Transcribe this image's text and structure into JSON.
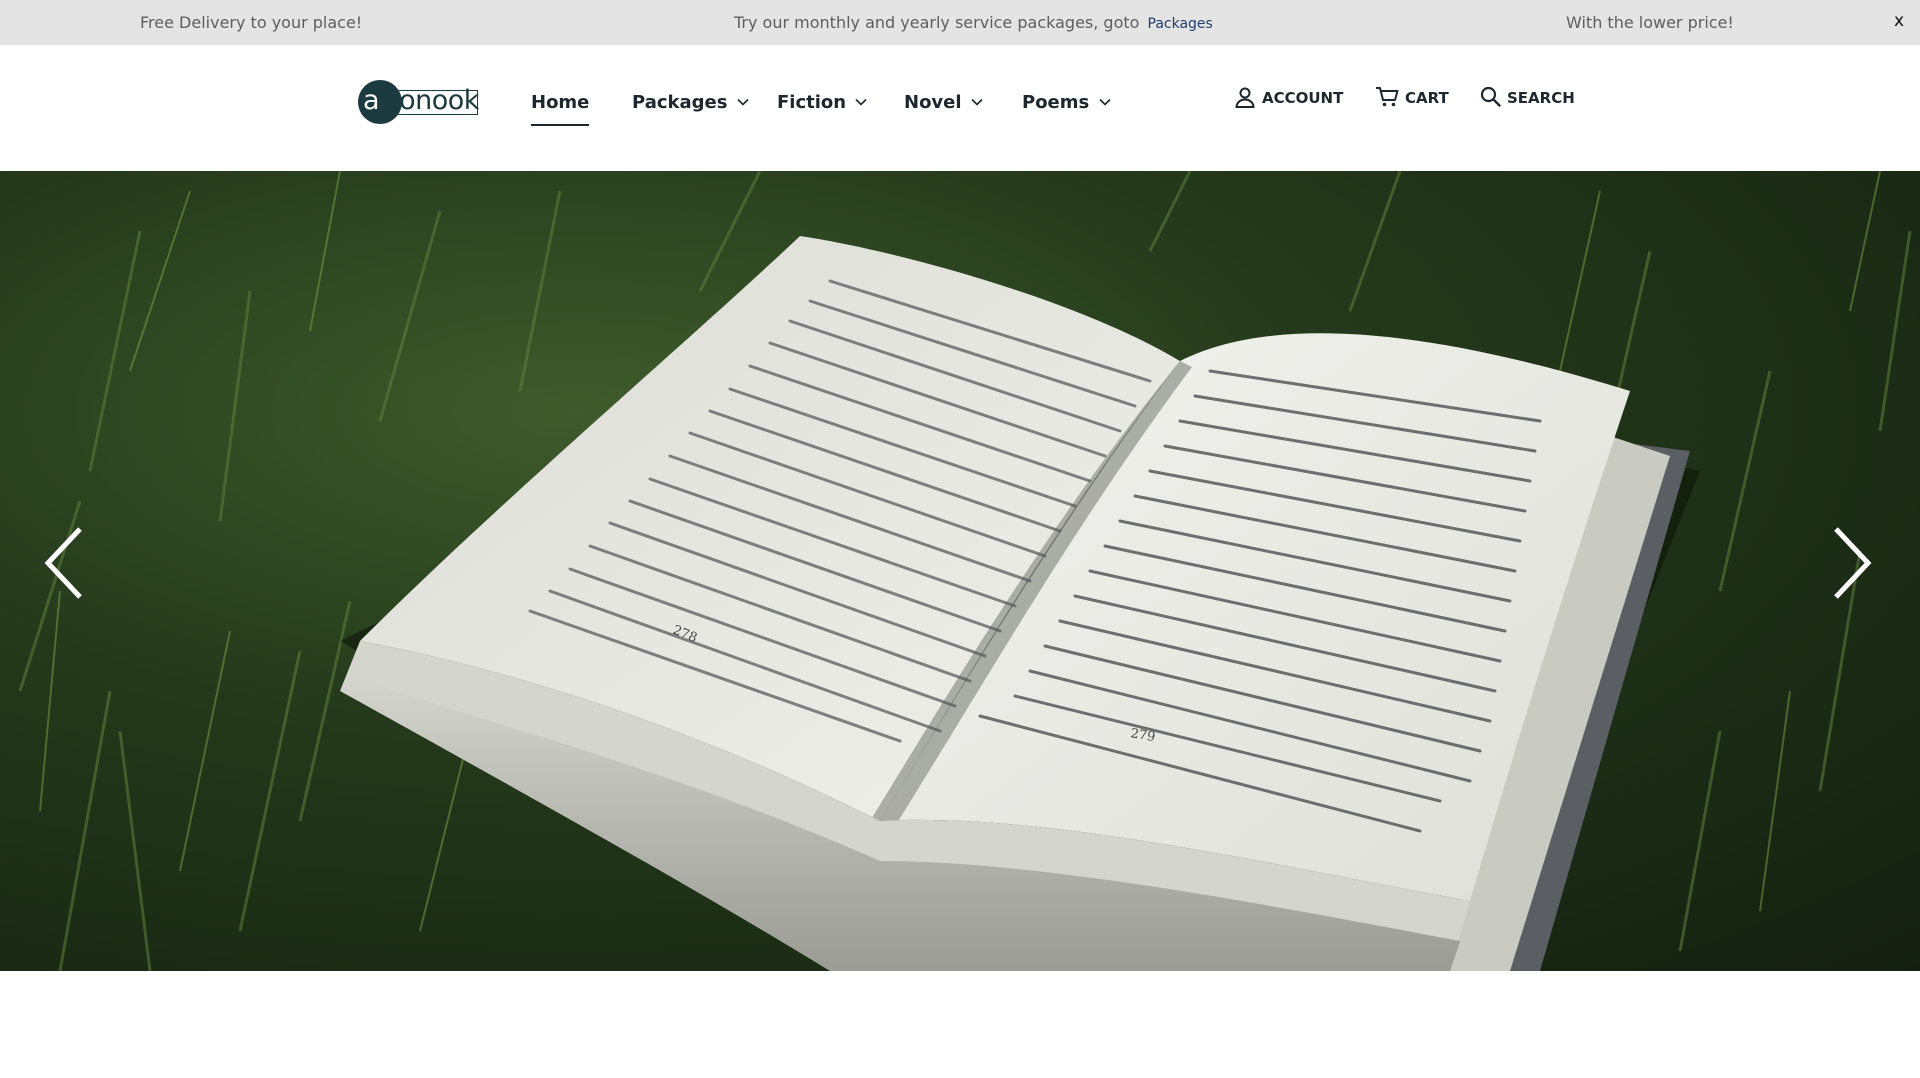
{
  "announcement": {
    "left_text": "Free Delivery to your place!",
    "center_text": "Try our monthly and yearly service packages, goto",
    "center_link": "Packages",
    "right_text": "With the lower price!",
    "close_label": "x"
  },
  "logo": {
    "first_letter": "a",
    "rest": "tronook"
  },
  "nav": {
    "home": "Home",
    "packages": "Packages",
    "fiction": "Fiction",
    "novel": "Novel",
    "poems": "Poems"
  },
  "utility": {
    "account": "ACCOUNT",
    "cart": "CART",
    "search": "SEARCH"
  },
  "hero": {
    "image": "open-book-on-grass",
    "page_left_number": "278",
    "page_right_number": "279"
  },
  "colors": {
    "topbar_bg": "#e4e4e4",
    "link": "#223f74",
    "brand_dark": "#1b3b40",
    "nav_text": "#1c2730"
  }
}
